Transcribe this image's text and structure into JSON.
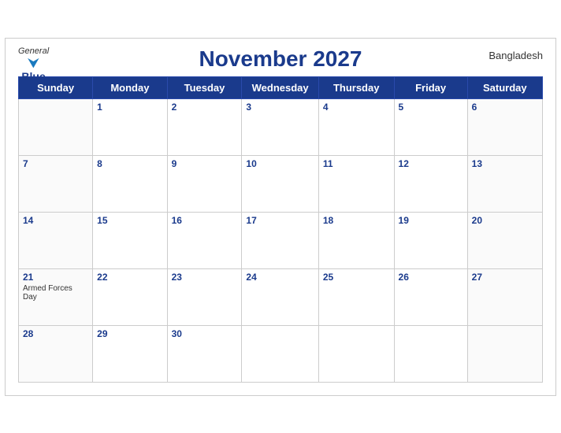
{
  "header": {
    "logo_general": "General",
    "logo_blue": "Blue",
    "title": "November 2027",
    "country": "Bangladesh"
  },
  "weekdays": [
    "Sunday",
    "Monday",
    "Tuesday",
    "Wednesday",
    "Thursday",
    "Friday",
    "Saturday"
  ],
  "weeks": [
    [
      {
        "day": "",
        "holiday": ""
      },
      {
        "day": "1",
        "holiday": ""
      },
      {
        "day": "2",
        "holiday": ""
      },
      {
        "day": "3",
        "holiday": ""
      },
      {
        "day": "4",
        "holiday": ""
      },
      {
        "day": "5",
        "holiday": ""
      },
      {
        "day": "6",
        "holiday": ""
      }
    ],
    [
      {
        "day": "7",
        "holiday": ""
      },
      {
        "day": "8",
        "holiday": ""
      },
      {
        "day": "9",
        "holiday": ""
      },
      {
        "day": "10",
        "holiday": ""
      },
      {
        "day": "11",
        "holiday": ""
      },
      {
        "day": "12",
        "holiday": ""
      },
      {
        "day": "13",
        "holiday": ""
      }
    ],
    [
      {
        "day": "14",
        "holiday": ""
      },
      {
        "day": "15",
        "holiday": ""
      },
      {
        "day": "16",
        "holiday": ""
      },
      {
        "day": "17",
        "holiday": ""
      },
      {
        "day": "18",
        "holiday": ""
      },
      {
        "day": "19",
        "holiday": ""
      },
      {
        "day": "20",
        "holiday": ""
      }
    ],
    [
      {
        "day": "21",
        "holiday": "Armed Forces Day"
      },
      {
        "day": "22",
        "holiday": ""
      },
      {
        "day": "23",
        "holiday": ""
      },
      {
        "day": "24",
        "holiday": ""
      },
      {
        "day": "25",
        "holiday": ""
      },
      {
        "day": "26",
        "holiday": ""
      },
      {
        "day": "27",
        "holiday": ""
      }
    ],
    [
      {
        "day": "28",
        "holiday": ""
      },
      {
        "day": "29",
        "holiday": ""
      },
      {
        "day": "30",
        "holiday": ""
      },
      {
        "day": "",
        "holiday": ""
      },
      {
        "day": "",
        "holiday": ""
      },
      {
        "day": "",
        "holiday": ""
      },
      {
        "day": "",
        "holiday": ""
      }
    ]
  ]
}
